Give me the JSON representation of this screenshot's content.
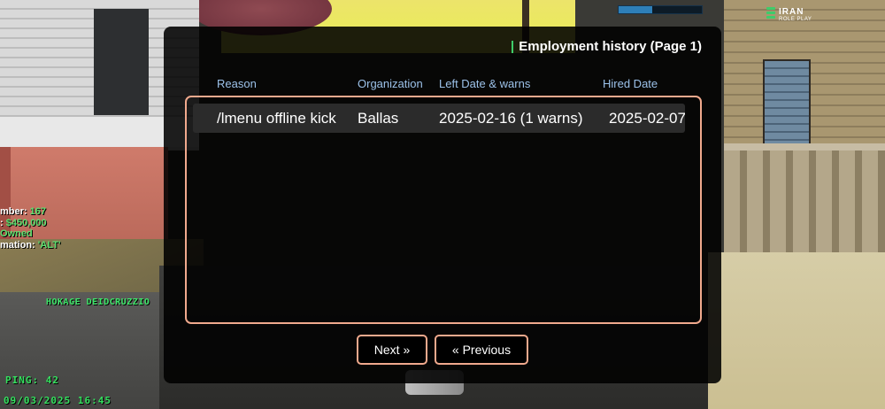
{
  "hud": {
    "logo_line1": "IRAN",
    "logo_line2": "ROLE PLAY",
    "progress_fraction": 0.4,
    "accent_color": "#3fcc6a"
  },
  "side_info": {
    "line1_label": "mber: ",
    "line1_value": "167",
    "line2_label": ": ",
    "line2_value": "$450,000",
    "line3_value": "Owned",
    "line4_label": "mation: ",
    "line4_value": "'ALT'"
  },
  "player_nametag": "HOKAGE DEIDCRUZZIO",
  "ping_text": "PING: 42",
  "datetime_text": "09/03/2025 16:45",
  "dialog": {
    "title": "Employment history (Page 1)",
    "columns": [
      "Reason",
      "Organization",
      "Left Date & warns",
      "Hired Date"
    ],
    "rows": [
      [
        "/lmenu offline kick",
        "Ballas",
        "2025-02-16 (1 warns)",
        "2025-02-07"
      ]
    ],
    "next_label": "Next »",
    "previous_label": "« Previous",
    "border_color": "#f0a98d",
    "header_color": "#9cc2ea"
  }
}
